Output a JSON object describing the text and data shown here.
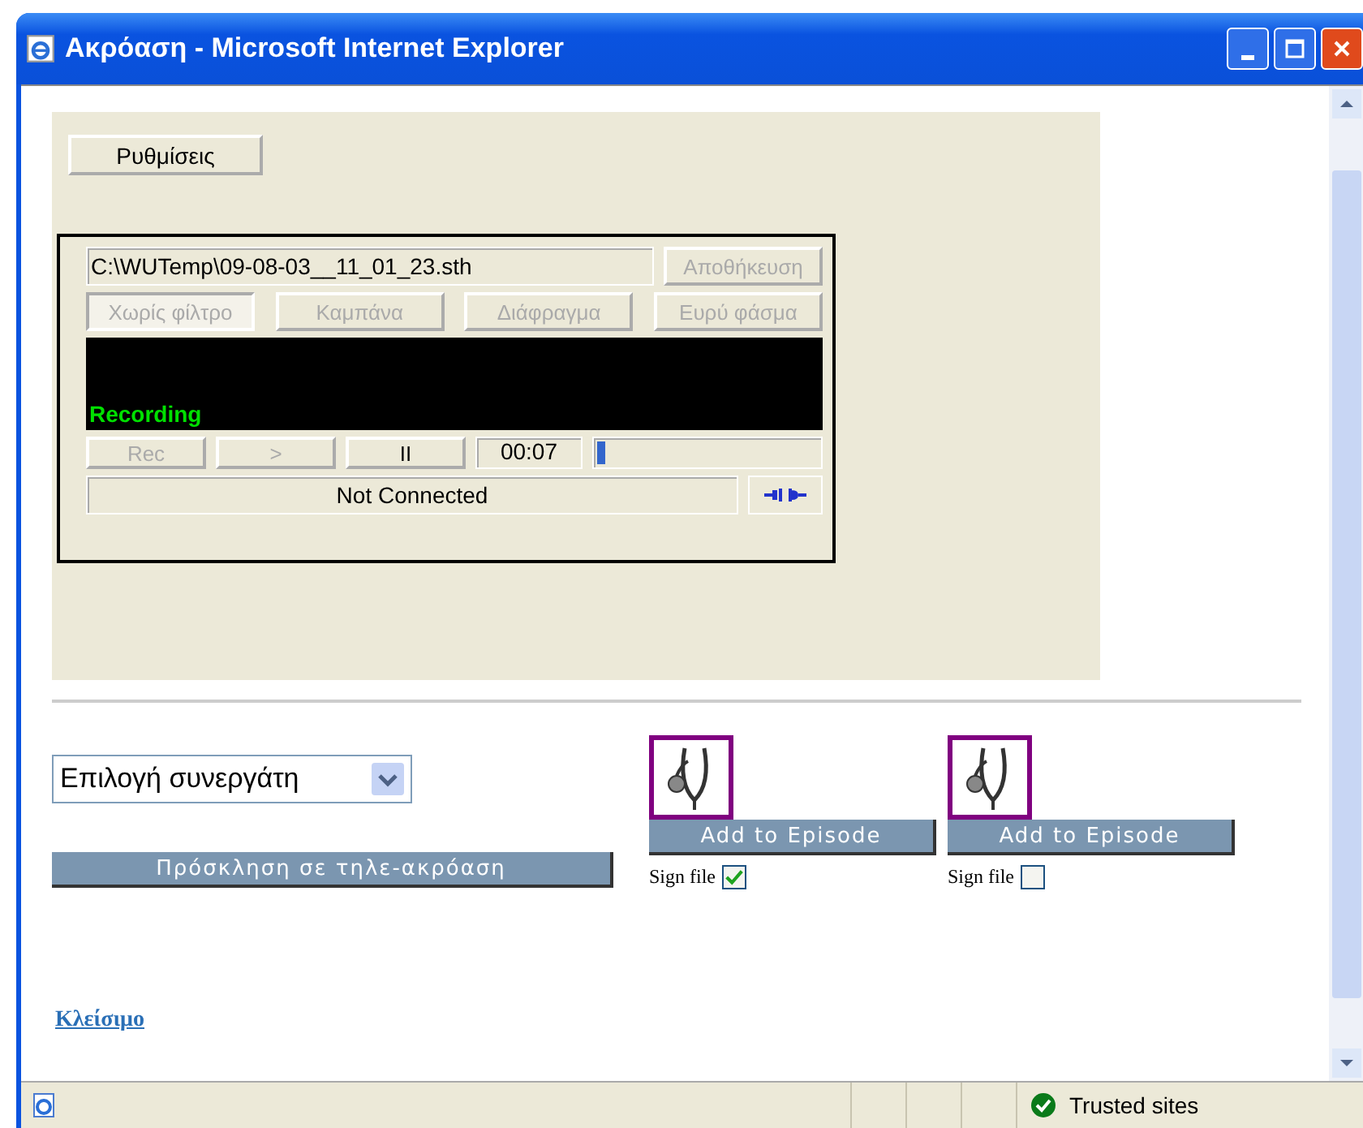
{
  "window": {
    "title": "Ακρόαση - Microsoft Internet Explorer"
  },
  "settings_button": "Ρυθμίσεις",
  "recorder": {
    "file_path": "C:\\WUTemp\\09-08-03__11_01_23.sth",
    "save_button": {
      "label": "Αποθήκευση",
      "disabled": true
    },
    "filters": [
      {
        "label": "Χωρίς φίλτρο",
        "selected": true
      },
      {
        "label": "Καμπάνα",
        "selected": false
      },
      {
        "label": "Διάφραγμα",
        "selected": false
      },
      {
        "label": "Ευρύ φάσμα",
        "selected": false
      }
    ],
    "display_status": "Recording",
    "transport": [
      {
        "label": "Rec",
        "disabled": true
      },
      {
        "label": ">",
        "disabled": true
      },
      {
        "label": "II",
        "disabled": false
      }
    ],
    "time": "00:07",
    "progress": {
      "level": 0.04
    },
    "connection": "Not Connected"
  },
  "partner_select": "Επιλογή συνεργάτη",
  "invite_button": "Πρόσκληση σε τηλε-ακρόαση",
  "files": [
    {
      "button": "Add to Episode",
      "sign_label": "Sign file",
      "checked": true
    },
    {
      "button": "Add to Episode",
      "sign_label": "Sign file",
      "checked": false
    }
  ],
  "close_link": "Κλείσιμο",
  "status_bar": {
    "zone": "Trusted sites"
  }
}
